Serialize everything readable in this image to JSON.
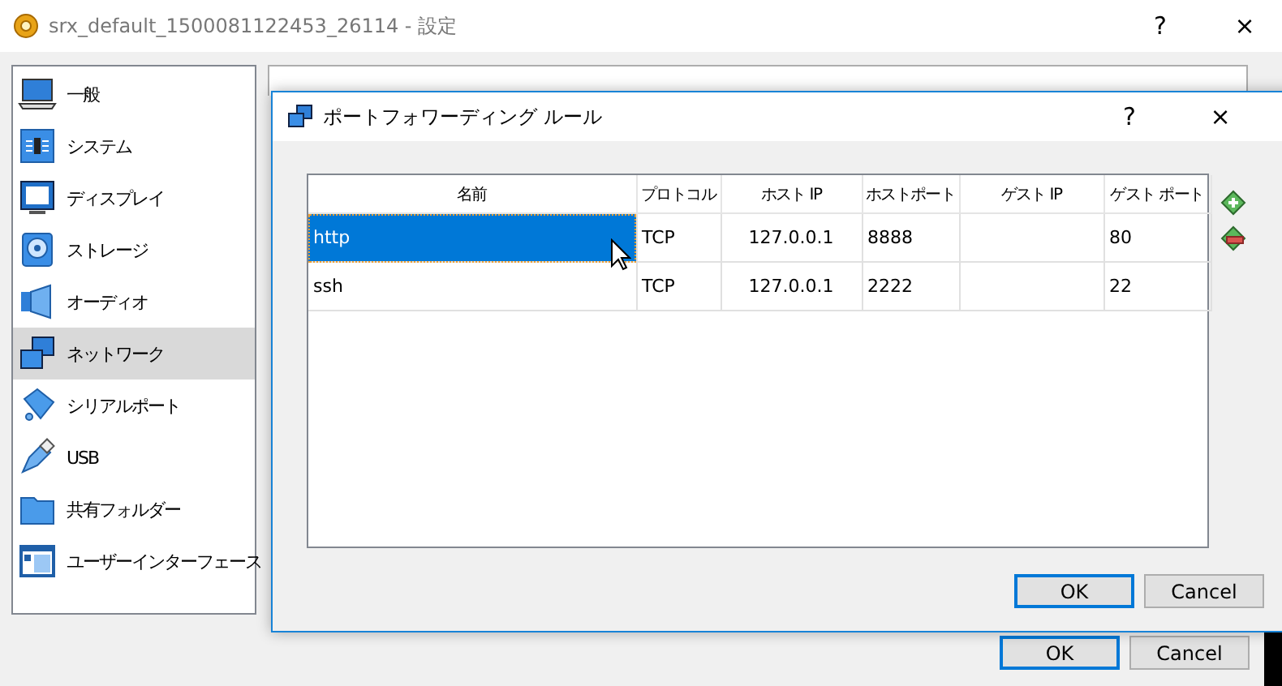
{
  "window": {
    "title": "srx_default_1500081122453_26114 - 設定",
    "help": "?",
    "close": "×"
  },
  "sidebar": {
    "items": [
      {
        "label": "一般",
        "kind": "general",
        "selected": false
      },
      {
        "label": "システム",
        "kind": "system",
        "selected": false
      },
      {
        "label": "ディスプレイ",
        "kind": "display",
        "selected": false
      },
      {
        "label": "ストレージ",
        "kind": "storage",
        "selected": false
      },
      {
        "label": "オーディオ",
        "kind": "audio",
        "selected": false
      },
      {
        "label": "ネットワーク",
        "kind": "network",
        "selected": true
      },
      {
        "label": "シリアルポート",
        "kind": "serial",
        "selected": false
      },
      {
        "label": "USB",
        "kind": "usb",
        "selected": false
      },
      {
        "label": "共有フォルダー",
        "kind": "folder",
        "selected": false
      },
      {
        "label": "ユーザーインターフェース",
        "kind": "ui",
        "selected": false
      }
    ]
  },
  "dialog": {
    "title": "ポートフォワーディング ルール",
    "help": "?",
    "close": "×",
    "table": {
      "columns": [
        "名前",
        "プロトコル",
        "ホスト IP",
        "ホストポート",
        "ゲスト IP",
        "ゲスト ポート"
      ],
      "rows": [
        {
          "cells": [
            "http",
            "TCP",
            "127.0.0.1",
            "8888",
            "",
            "80"
          ],
          "selected": true
        },
        {
          "cells": [
            "ssh",
            "TCP",
            "127.0.0.1",
            "2222",
            "",
            "22"
          ],
          "selected": false
        }
      ]
    },
    "buttons": [
      {
        "label": "OK",
        "default": true
      },
      {
        "label": "Cancel",
        "default": false
      }
    ]
  },
  "buttons": [
    {
      "label": "OK",
      "default": true
    },
    {
      "label": "Cancel",
      "default": false
    }
  ]
}
